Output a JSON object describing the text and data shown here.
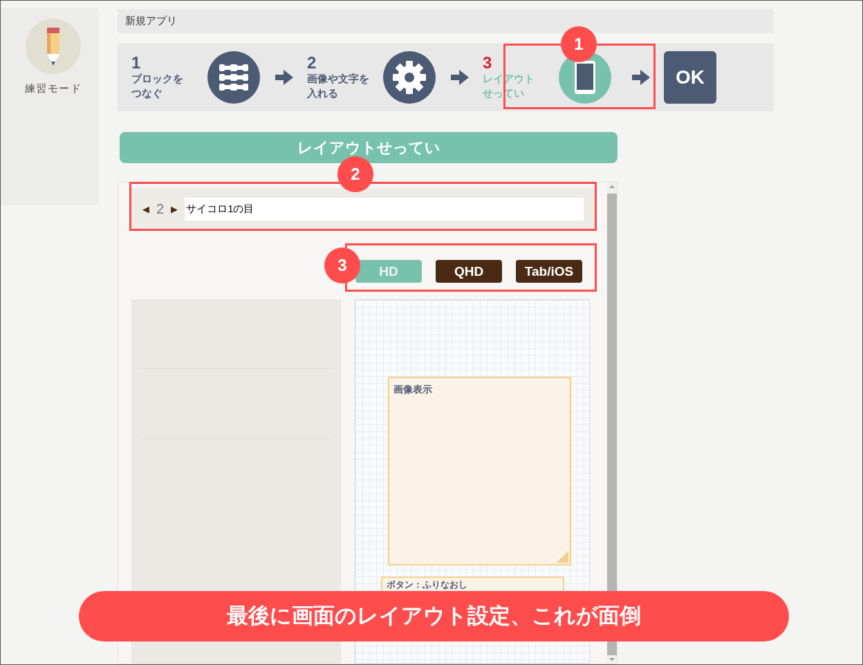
{
  "sidebar": {
    "items": [
      {
        "label": "練習モード",
        "kind": "pencil"
      }
    ]
  },
  "app_title": "新規アプリ",
  "steps": [
    {
      "number": "1",
      "label_lines": [
        "ブロックを",
        "つなぐ"
      ],
      "kind": "blocks",
      "selected": false
    },
    {
      "number": "2",
      "label_lines": [
        "画像や文字を",
        "入れる"
      ],
      "kind": "gear",
      "selected": false
    },
    {
      "number": "3",
      "label_lines": [
        "レイアウト",
        "せってい"
      ],
      "kind": "phone",
      "selected": true
    }
  ],
  "ok_button": "OK",
  "section_title": "レイアウトせってい",
  "screen_nav": {
    "prev": "◀",
    "page": "2",
    "next": "▶",
    "screen_name": "サイコロ1の目"
  },
  "resolutions": [
    {
      "label": "HD",
      "selected": true
    },
    {
      "label": "QHD",
      "selected": false
    },
    {
      "label": "Tab/iOS",
      "selected": false
    }
  ],
  "canvas_items": [
    {
      "label": "画像表示",
      "kind": "image"
    },
    {
      "label": "ボタン：ふりなおし",
      "kind": "button"
    }
  ],
  "callouts": [
    "1",
    "2",
    "3"
  ],
  "banner": "最後に画面のレイアウト設定、これが面倒"
}
